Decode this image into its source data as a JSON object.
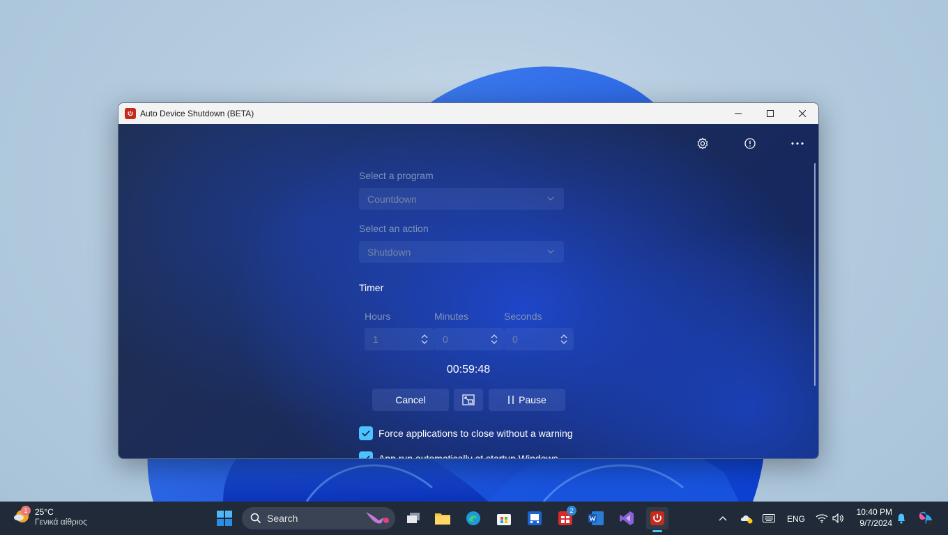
{
  "window": {
    "title": "Auto Device Shutdown (BETA)"
  },
  "form": {
    "program_label": "Select a program",
    "program_value": "Countdown",
    "action_label": "Select an action",
    "action_value": "Shutdown",
    "timer_label": "Timer",
    "hours_label": "Hours",
    "hours_value": "1",
    "minutes_label": "Minutes",
    "minutes_value": "0",
    "seconds_label": "Seconds",
    "seconds_value": "0",
    "countdown": "00:59:48",
    "cancel_label": "Cancel",
    "pause_label": "Pause",
    "force_close_label": "Force applications to close without a warning",
    "autostart_label": "App run automatically at startup Windows"
  },
  "taskbar": {
    "weather_badge": "1",
    "temperature": "25°C",
    "weather_desc": "Γενικά αίθριος",
    "search_label": "Search",
    "store_badge": "2",
    "lang": "ENG",
    "time": "10:40 PM",
    "date": "9/7/2024"
  },
  "colors": {
    "accent": "#4cc2ff",
    "app_icon": "#c42b1c"
  }
}
